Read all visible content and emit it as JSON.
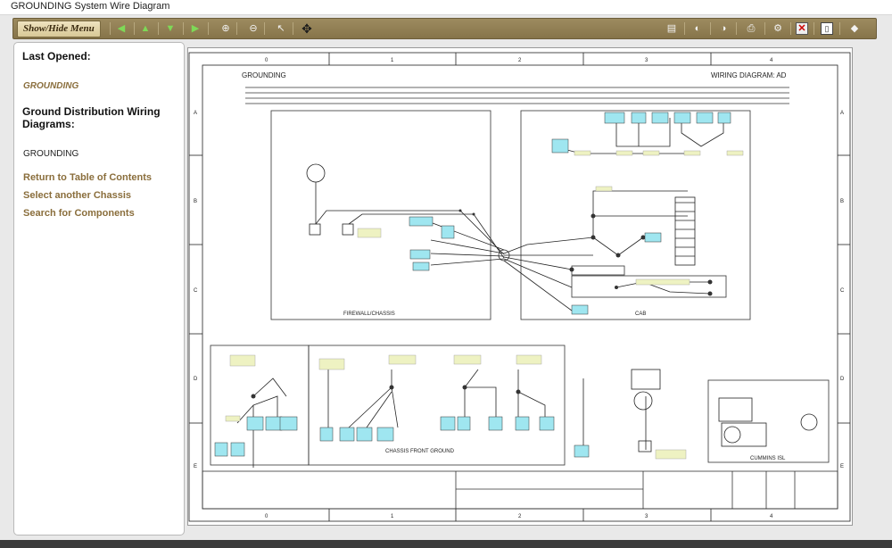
{
  "window": {
    "title": "GROUNDING System Wire Diagram"
  },
  "toolbar": {
    "menu_label": "Show/Hide Menu",
    "icons": [
      "back-arrow",
      "up-arrow",
      "down-arrow",
      "forward-arrow",
      "zoom-in",
      "zoom-out",
      "pointer",
      "pan-move",
      "legend",
      "previous",
      "next",
      "print",
      "settings",
      "close-red",
      "window",
      "home"
    ]
  },
  "sidebar": {
    "last_opened_heading": "Last Opened:",
    "last_opened_item": "GROUNDING",
    "section_heading": "Ground Distribution Wiring Diagrams:",
    "current_item": "GROUNDING",
    "links": [
      "Return to Table of Contents",
      "Select another Chassis",
      "Search for Components"
    ]
  },
  "diagram": {
    "title": "GROUNDING",
    "code": "WIRING DIAGRAM: AD",
    "columns": [
      "0",
      "1",
      "2",
      "3",
      "4"
    ],
    "rows": [
      "A",
      "B",
      "C",
      "D",
      "E"
    ],
    "panels": {
      "firewall": "FIREWALL/CHASSIS",
      "cab": "CAB",
      "front_ground": "CHASSIS FRONT GROUND",
      "cummins": "CUMMINS ISL"
    }
  },
  "colors": {
    "toolbar": "#8f7d52",
    "link": "#8a6e3c",
    "connector": "#9fe6f0",
    "label_tag": "#eef2c2"
  }
}
